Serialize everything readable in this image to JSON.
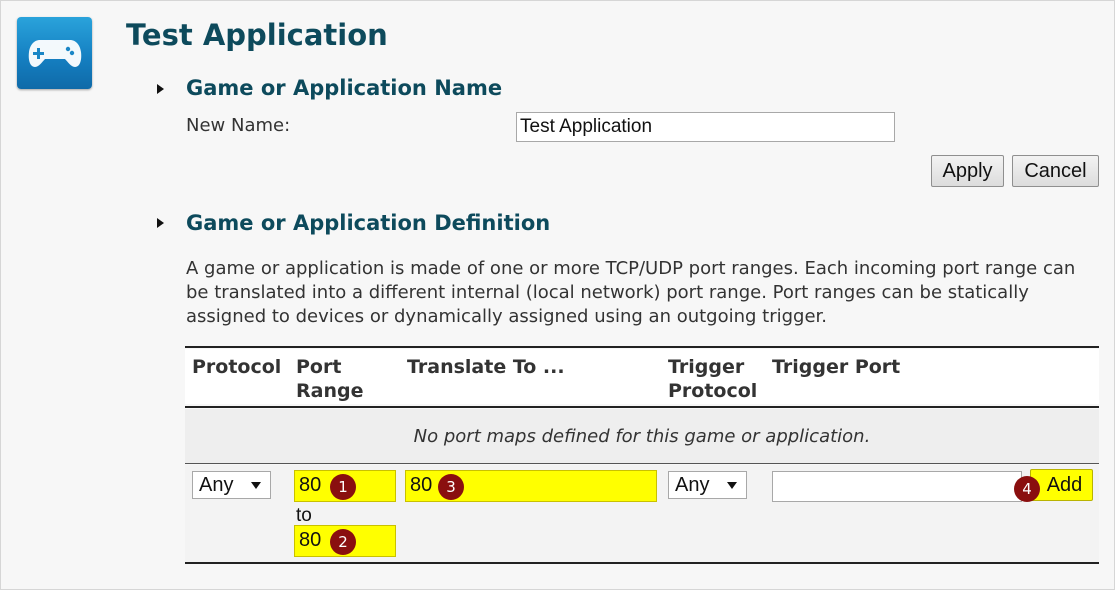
{
  "page": {
    "title": "Test Application",
    "icon": "gamepad-icon",
    "accent_color": "#0d4a5c"
  },
  "name_section": {
    "heading": "Game or Application Name",
    "new_name_label": "New Name:",
    "new_name_value": "Test Application",
    "apply_label": "Apply",
    "cancel_label": "Cancel"
  },
  "definition_section": {
    "heading": "Game or Application Definition",
    "description": "A game or application is made of one or more TCP/UDP port ranges. Each incoming port range can be translated into a different internal (local network) port range. Port ranges can be statically assigned to devices or dynamically assigned using an outgoing trigger.",
    "table": {
      "headers": {
        "protocol": "Protocol",
        "port_range_line1": "Port",
        "port_range_line2": "Range",
        "translate_to": "Translate To ...",
        "trigger_protocol_line1": "Trigger",
        "trigger_protocol_line2": "Protocol",
        "trigger_port": "Trigger Port"
      },
      "empty_message": "No port maps defined for this game or application.",
      "add_row": {
        "protocol": "Any",
        "port_start": "80",
        "to_label": "to",
        "port_end": "80",
        "translate_to": "80",
        "trigger_protocol": "Any",
        "trigger_port": "",
        "add_label": "Add"
      }
    }
  },
  "callouts": {
    "port_start": "1",
    "port_end": "2",
    "translate_to": "3",
    "add": "4",
    "highlight_color": "#ffff00",
    "badge_color": "#8a0f0f"
  }
}
